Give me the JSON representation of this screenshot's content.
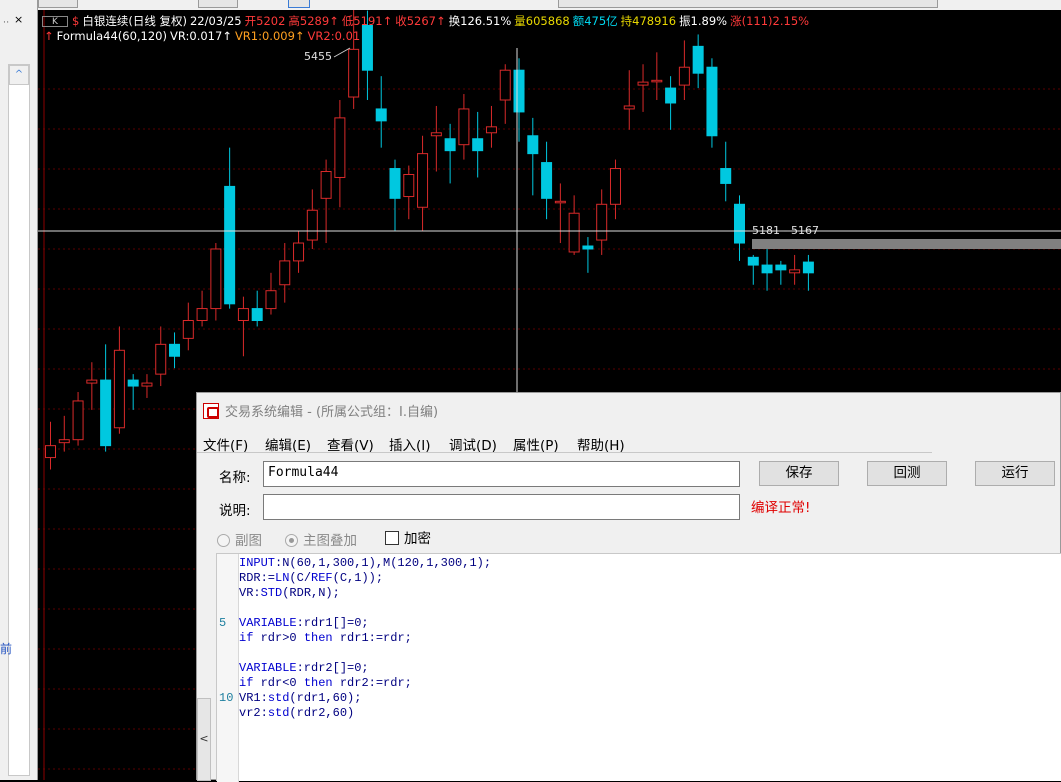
{
  "header": {
    "k_button": "K",
    "line1": [
      {
        "text": "$",
        "color": "#ff3a3a"
      },
      {
        "text": "白银连续(日线 复权)",
        "color": "#ffffff"
      },
      {
        "text": "22/03/25",
        "color": "#ffffff"
      },
      {
        "text": "开5202",
        "color": "#ff3a3a"
      },
      {
        "text": "高5289↑",
        "color": "#ff3a3a"
      },
      {
        "text": "低5191↑",
        "color": "#ff3a3a"
      },
      {
        "text": "收5267↑",
        "color": "#ff3a3a"
      },
      {
        "text": "换126.51%",
        "color": "#ffffff"
      },
      {
        "text": "量605868",
        "color": "#e8d800"
      },
      {
        "text": "额475亿",
        "color": "#00d8f0"
      },
      {
        "text": "持478916",
        "color": "#e8d800"
      },
      {
        "text": "振1.89%",
        "color": "#ffffff"
      },
      {
        "text": "涨(111)2.15%",
        "color": "#ff3a3a"
      }
    ],
    "line2": [
      {
        "text": "↑",
        "color": "#ff3a3a"
      },
      {
        "text": "Formula44(60,120)",
        "color": "#ffffff"
      },
      {
        "text": "VR:0.017↑",
        "color": "#ffffff"
      },
      {
        "text": "VR1:0.009↑",
        "color": "#ffa020"
      },
      {
        "text": "VR2:0.01",
        "color": "#ff3a3a"
      }
    ]
  },
  "chart_data": {
    "type": "candlestick",
    "peak_label": "5455",
    "price_tag": "5181 - 5167",
    "up_color": "#d92a2a",
    "down_color": "#00c8e0",
    "candles": [
      {
        "o": 5040,
        "c": 5060,
        "h": 5100,
        "l": 5020
      },
      {
        "o": 5065,
        "c": 5070,
        "h": 5110,
        "l": 5050
      },
      {
        "o": 5070,
        "c": 5135,
        "h": 5150,
        "l": 5060
      },
      {
        "o": 5165,
        "c": 5170,
        "h": 5200,
        "l": 5120
      },
      {
        "o": 5170,
        "c": 5060,
        "h": 5230,
        "l": 5050
      },
      {
        "o": 5090,
        "c": 5220,
        "h": 5260,
        "l": 5080
      },
      {
        "o": 5170,
        "c": 5160,
        "h": 5180,
        "l": 5120
      },
      {
        "o": 5160,
        "c": 5165,
        "h": 5180,
        "l": 5140
      },
      {
        "o": 5180,
        "c": 5230,
        "h": 5260,
        "l": 5160
      },
      {
        "o": 5230,
        "c": 5210,
        "h": 5250,
        "l": 5190
      },
      {
        "o": 5240,
        "c": 5270,
        "h": 5300,
        "l": 5220
      },
      {
        "o": 5270,
        "c": 5290,
        "h": 5320,
        "l": 5260
      },
      {
        "o": 5290,
        "c": 5390,
        "h": 5400,
        "l": 5270
      },
      {
        "o": 5495,
        "c": 5298,
        "h": 5560,
        "l": 5290
      },
      {
        "o": 5270,
        "c": 5290,
        "h": 5310,
        "l": 5210
      },
      {
        "o": 5290,
        "c": 5270,
        "h": 5320,
        "l": 5260
      },
      {
        "o": 5290,
        "c": 5320,
        "h": 5350,
        "l": 5280
      },
      {
        "o": 5330,
        "c": 5370,
        "h": 5400,
        "l": 5300
      },
      {
        "o": 5370,
        "c": 5400,
        "h": 5420,
        "l": 5350
      },
      {
        "o": 5405,
        "c": 5455,
        "h": 5490,
        "l": 5390
      },
      {
        "o": 5475,
        "c": 5520,
        "h": 5540,
        "l": 5400
      },
      {
        "o": 5510,
        "c": 5610,
        "h": 5640,
        "l": 5460
      },
      {
        "o": 5645,
        "c": 5725,
        "h": 5795,
        "l": 5625
      },
      {
        "o": 5765,
        "c": 5690,
        "h": 5790,
        "l": 5640
      },
      {
        "o": 5625,
        "c": 5605,
        "h": 5680,
        "l": 5560
      },
      {
        "o": 5525,
        "c": 5475,
        "h": 5540,
        "l": 5420
      },
      {
        "o": 5478,
        "c": 5515,
        "h": 5530,
        "l": 5440
      },
      {
        "o": 5460,
        "c": 5550,
        "h": 5580,
        "l": 5420
      },
      {
        "o": 5580,
        "c": 5585,
        "h": 5630,
        "l": 5520
      },
      {
        "o": 5575,
        "c": 5555,
        "h": 5600,
        "l": 5500
      },
      {
        "o": 5565,
        "c": 5625,
        "h": 5650,
        "l": 5540
      },
      {
        "o": 5575,
        "c": 5555,
        "h": 5620,
        "l": 5510
      },
      {
        "o": 5585,
        "c": 5595,
        "h": 5630,
        "l": 5560
      },
      {
        "o": 5640,
        "c": 5690,
        "h": 5700,
        "l": 5600
      },
      {
        "o": 5690,
        "c": 5620,
        "h": 5710,
        "l": 5570
      },
      {
        "o": 5580,
        "c": 5550,
        "h": 5610,
        "l": 5480
      },
      {
        "o": 5535,
        "c": 5475,
        "h": 5570,
        "l": 5440
      },
      {
        "o": 5468,
        "c": 5470,
        "h": 5500,
        "l": 5400
      },
      {
        "o": 5385,
        "c": 5450,
        "h": 5480,
        "l": 5380
      },
      {
        "o": 5395,
        "c": 5390,
        "h": 5410,
        "l": 5350
      },
      {
        "o": 5405,
        "c": 5465,
        "h": 5490,
        "l": 5380
      },
      {
        "o": 5465,
        "c": 5525,
        "h": 5540,
        "l": 5440
      },
      {
        "o": 5625,
        "c": 5630,
        "h": 5690,
        "l": 5590
      },
      {
        "o": 5665,
        "c": 5670,
        "h": 5700,
        "l": 5620
      },
      {
        "o": 5672,
        "c": 5673,
        "h": 5720,
        "l": 5640
      },
      {
        "o": 5660,
        "c": 5635,
        "h": 5680,
        "l": 5590
      },
      {
        "o": 5665,
        "c": 5695,
        "h": 5740,
        "l": 5640
      },
      {
        "o": 5730,
        "c": 5685,
        "h": 5750,
        "l": 5660
      },
      {
        "o": 5695,
        "c": 5580,
        "h": 5710,
        "l": 5560
      },
      {
        "o": 5525,
        "c": 5500,
        "h": 5570,
        "l": 5470
      },
      {
        "o": 5465,
        "c": 5400,
        "h": 5480,
        "l": 5370
      },
      {
        "o": 5376,
        "c": 5363,
        "h": 5380,
        "l": 5330
      },
      {
        "o": 5363,
        "c": 5350,
        "h": 5390,
        "l": 5320
      },
      {
        "o": 5363,
        "c": 5355,
        "h": 5370,
        "l": 5330
      },
      {
        "o": 5350,
        "c": 5355,
        "h": 5380,
        "l": 5330
      },
      {
        "o": 5368,
        "c": 5350,
        "h": 5380,
        "l": 5320
      }
    ]
  },
  "editor": {
    "title": "交易系统编辑 - (所属公式组：I.自编)",
    "menu": [
      "文件(F)",
      "编辑(E)",
      "查看(V)",
      "插入(I)",
      "调试(D)",
      "属性(P)",
      "帮助(H)"
    ],
    "name_label": "名称:",
    "name_value": "Formula44",
    "desc_label": "说明:",
    "desc_value": "",
    "save_label": "保存",
    "backtest_label": "回测",
    "run_label": "运行",
    "compile_status": "编译正常!",
    "radio_sub": "副图",
    "radio_main": "主图叠加",
    "encrypt_label": "加密",
    "side_arrow": "<",
    "line_numbers": [
      {
        "n": "5",
        "row": 4
      },
      {
        "n": "10",
        "row": 9
      }
    ],
    "code": [
      [
        {
          "t": "INPUT",
          "c": "#0000d0"
        },
        {
          "t": ":N(60,1,300,1),M(120,1,300,1);",
          "c": "#000080"
        }
      ],
      [
        {
          "t": "RDR:=",
          "c": "#000080"
        },
        {
          "t": "LN",
          "c": "#0000d0"
        },
        {
          "t": "(C/",
          "c": "#000080"
        },
        {
          "t": "REF",
          "c": "#0000d0"
        },
        {
          "t": "(C,1));",
          "c": "#000080"
        }
      ],
      [
        {
          "t": "VR:",
          "c": "#000080"
        },
        {
          "t": "STD",
          "c": "#0000d0"
        },
        {
          "t": "(RDR,N);",
          "c": "#000080"
        }
      ],
      [],
      [
        {
          "t": "VARIABLE",
          "c": "#0000d0"
        },
        {
          "t": ":rdr1[]=0;",
          "c": "#000080"
        }
      ],
      [
        {
          "t": "if",
          "c": "#0000d0"
        },
        {
          "t": " rdr>0 ",
          "c": "#000080"
        },
        {
          "t": "then",
          "c": "#0000d0"
        },
        {
          "t": " rdr1:=rdr;",
          "c": "#000080"
        }
      ],
      [],
      [
        {
          "t": "VARIABLE",
          "c": "#0000d0"
        },
        {
          "t": ":rdr2[]=0;",
          "c": "#000080"
        }
      ],
      [
        {
          "t": "if",
          "c": "#0000d0"
        },
        {
          "t": " rdr<0 ",
          "c": "#000080"
        },
        {
          "t": "then",
          "c": "#0000d0"
        },
        {
          "t": " rdr2:=rdr;",
          "c": "#000080"
        }
      ],
      [
        {
          "t": "VR1:",
          "c": "#000080"
        },
        {
          "t": "std",
          "c": "#0000d0"
        },
        {
          "t": "(rdr1,60);",
          "c": "#000080"
        }
      ],
      [
        {
          "t": "vr2:",
          "c": "#000080"
        },
        {
          "t": "std",
          "c": "#0000d0"
        },
        {
          "t": "(rdr2,60)",
          "c": "#000080"
        }
      ]
    ]
  },
  "left_strip": {
    "pin_icon": "ᆞ",
    "close_glyph": "×",
    "bottom_char": "前"
  }
}
